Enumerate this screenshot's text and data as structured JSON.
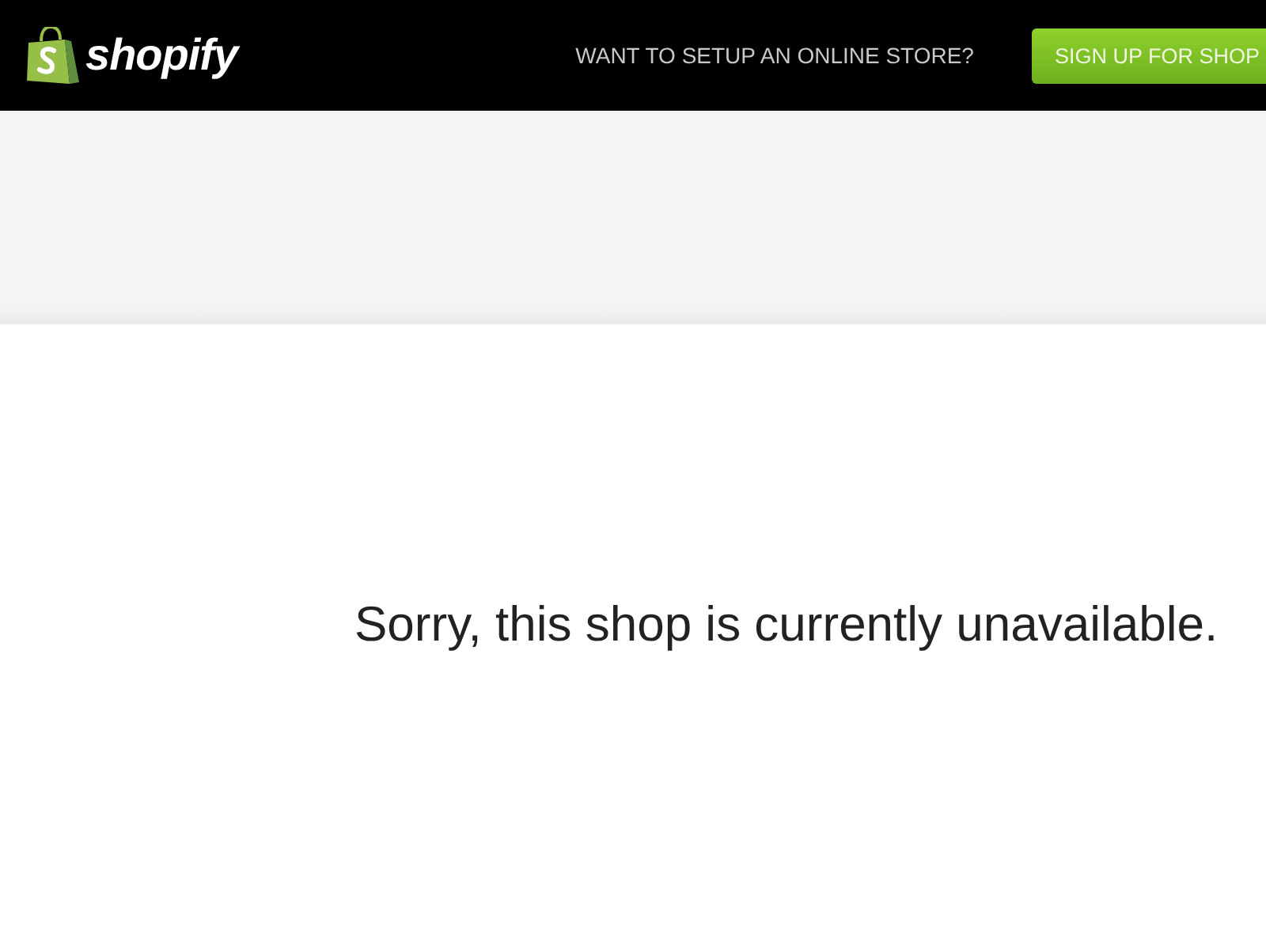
{
  "header": {
    "logo": {
      "wordmark": "shopify"
    },
    "promo_text": "WANT TO SETUP AN ONLINE STORE?",
    "signup_button": "SIGN UP FOR SHOP"
  },
  "message": "Sorry, this shop is currently unavailable."
}
